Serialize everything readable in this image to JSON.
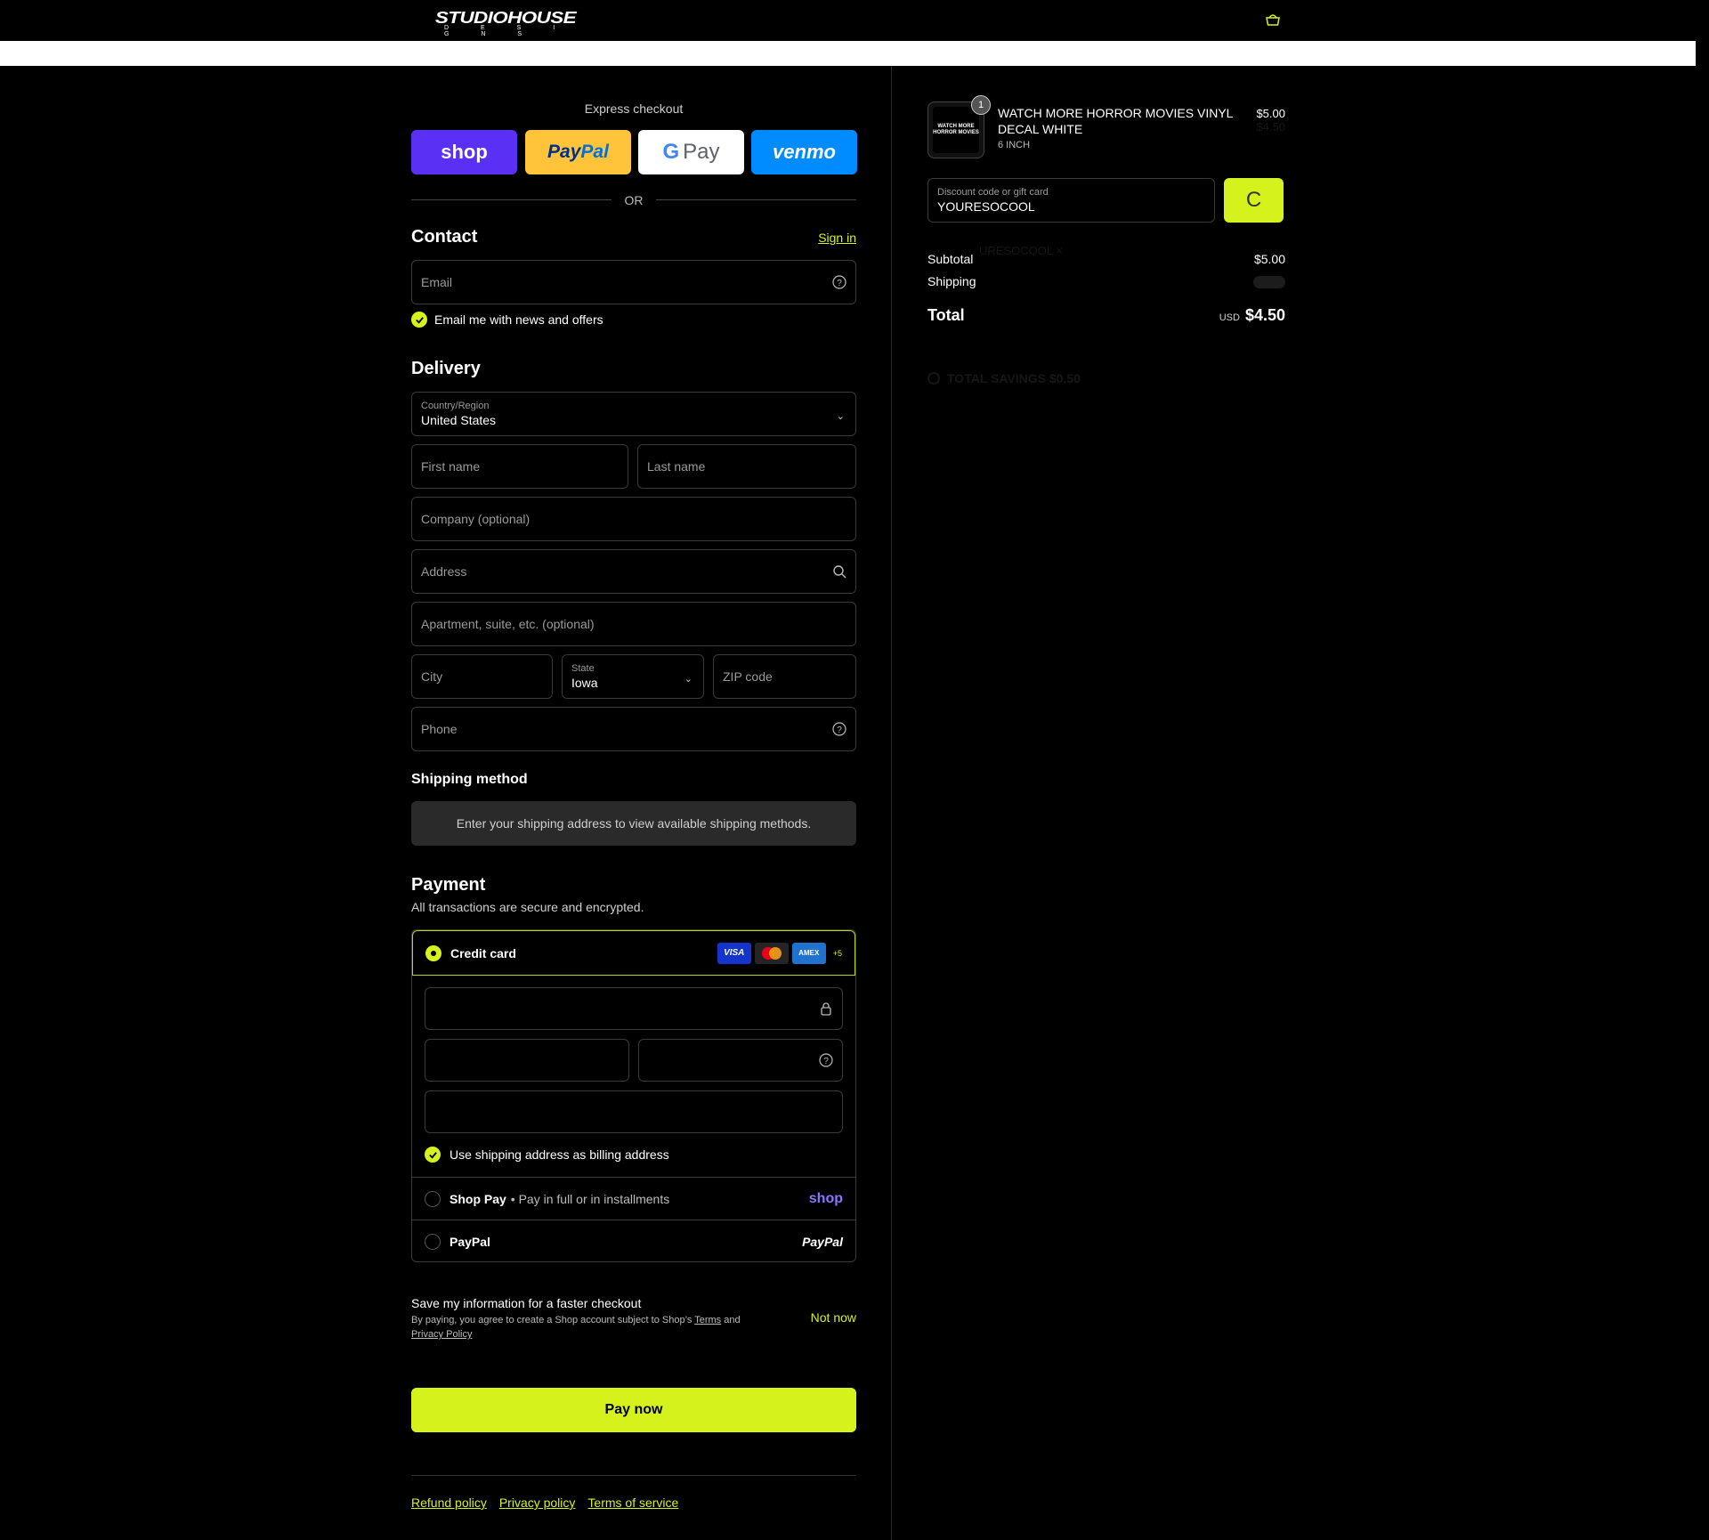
{
  "header": {
    "brand": "STUDIOHOUSE",
    "brand_sub": "D E S I G N S"
  },
  "express": {
    "title": "Express checkout",
    "shop": "shop",
    "paypal_a": "Pay",
    "paypal_b": "Pal",
    "gpay_g": "G",
    "gpay": "Pay",
    "venmo": "venmo",
    "or": "OR"
  },
  "contact": {
    "title": "Contact",
    "sign_in": "Sign in",
    "email_placeholder": "Email",
    "news_label": "Email me with news and offers"
  },
  "delivery": {
    "title": "Delivery",
    "country_label": "Country/Region",
    "country_value": "United States",
    "first_name": "First name",
    "last_name": "Last name",
    "company": "Company (optional)",
    "address": "Address",
    "apartment": "Apartment, suite, etc. (optional)",
    "city": "City",
    "state_label": "State",
    "state_value": "Iowa",
    "zip": "ZIP code",
    "phone": "Phone"
  },
  "shipping": {
    "title": "Shipping method",
    "message": "Enter your shipping address to view available shipping methods."
  },
  "payment": {
    "title": "Payment",
    "subtitle": "All transactions are secure and encrypted.",
    "credit_card": "Credit card",
    "visa": "VISA",
    "amex": "AMEX",
    "more": "+5",
    "billing_label": "Use shipping address as billing address",
    "shop_pay": "Shop Pay",
    "shop_pay_desc": "• Pay in full or in installments",
    "shop_logo": "shop",
    "paypal": "PayPal",
    "paypal_logo": "PayPal"
  },
  "save_info": {
    "title": "Save my information for a faster checkout",
    "text_a": "By paying, you agree to create a Shop account subject to Shop’s",
    "terms": "Terms",
    "and": "and",
    "privacy": "Privacy Policy",
    "not_now": "Not now"
  },
  "pay_now": "Pay now",
  "footer": {
    "refund": "Refund policy",
    "privacy": "Privacy policy",
    "terms": "Terms of service"
  },
  "summary": {
    "thumb_text": "WATCH MORE HORROR MOVIES",
    "qty": "1",
    "product_name": "WATCH MORE HORROR MOVIES VINYL DECAL WHITE",
    "variant": "6 INCH",
    "price": "$5.00",
    "price_faded": "$4.50",
    "discount_label": "Discount code or gift card",
    "discount_value": "YOURESOCOOL",
    "apply_icon": "C",
    "faded_code": "URESOCOOL ×",
    "subtotal_label": "Subtotal",
    "subtotal_value": "$5.00",
    "shipping_label": "Shipping",
    "total_label": "Total",
    "currency": "USD",
    "total_value": "$4.50",
    "savings_faded": "TOTAL SAVINGS $0.50"
  },
  "colors": {
    "accent": "#d6f21c",
    "background": "#000000",
    "shop_purple": "#5a31f4",
    "venmo_blue": "#008cff",
    "paypal_yellow": "#ffc439"
  }
}
